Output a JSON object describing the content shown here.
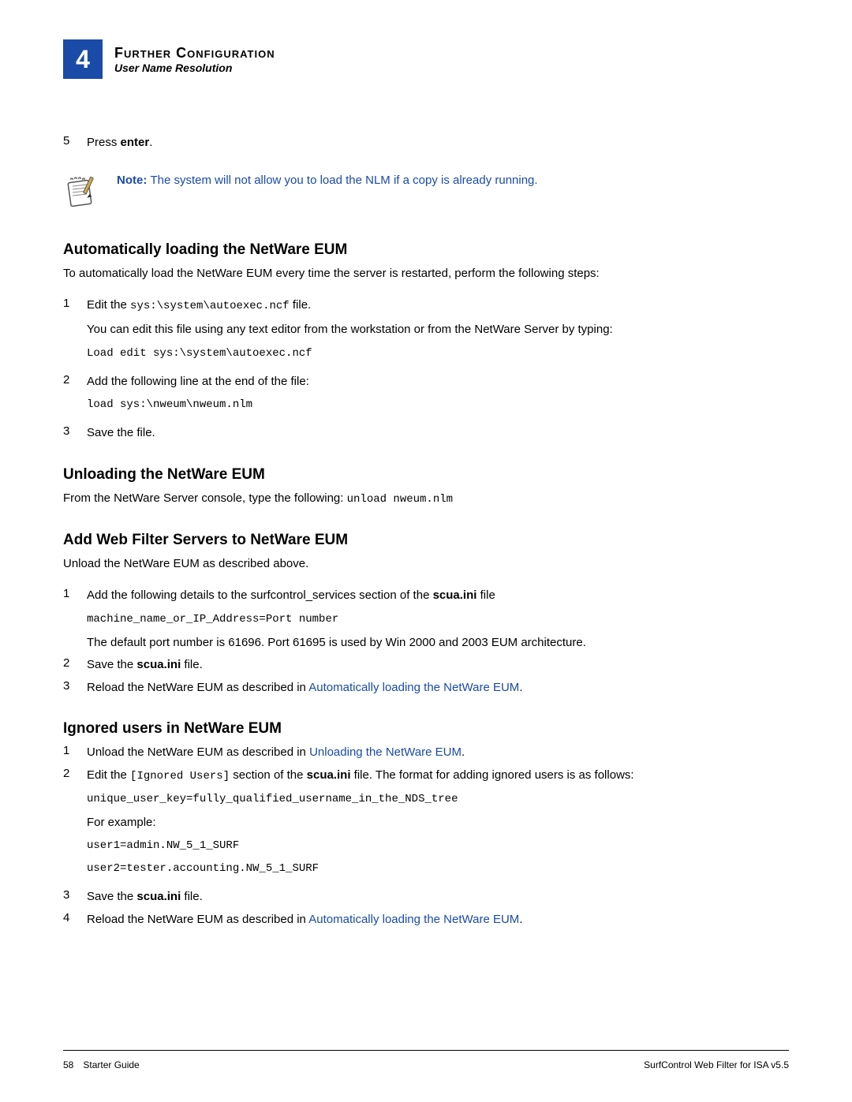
{
  "header": {
    "chapter_number": "4",
    "chapter_title": "Further Configuration",
    "section": "User Name Resolution"
  },
  "step5": {
    "num": "5",
    "pre": "Press ",
    "bold": "enter",
    "post": "."
  },
  "note": {
    "label": "Note: ",
    "text": "The system will not allow you to load the NLM if a copy is already running."
  },
  "auto": {
    "heading": "Automatically loading the NetWare EUM",
    "intro": "To automatically load the NetWare EUM every time the server is restarted, perform the following steps:",
    "s1": {
      "num": "1",
      "pre": "Edit the ",
      "code": "sys:\\system\\autoexec.ncf",
      "post": " file.",
      "line2": "You can edit this file using any text editor from the workstation or from the NetWare Server by typing:",
      "codeblock": "Load edit sys:\\system\\autoexec.ncf"
    },
    "s2": {
      "num": "2",
      "text": "Add the following line at the end of the file:",
      "codeblock": "load sys:\\nweum\\nweum.nlm"
    },
    "s3": {
      "num": "3",
      "text": "Save the file."
    }
  },
  "unload": {
    "heading": "Unloading the NetWare EUM",
    "pre": "From the NetWare Server console, type the following: ",
    "code": "unload nweum.nlm"
  },
  "addwf": {
    "heading": "Add Web Filter Servers to NetWare EUM",
    "intro": "Unload the NetWare EUM as described above.",
    "s1": {
      "num": "1",
      "pre": "Add the following details to the surfcontrol_services section of the ",
      "bold": "scua.ini",
      "post": " file",
      "codeblock": "machine_name_or_IP_Address=Port number",
      "line2": "The default port number is 61696. Port 61695 is used by Win 2000 and 2003 EUM architecture."
    },
    "s2": {
      "num": "2",
      "pre": "Save the ",
      "bold": "scua.ini",
      "post": " file."
    },
    "s3": {
      "num": "3",
      "pre": "Reload the NetWare EUM as described in ",
      "link": "Automatically loading the NetWare EUM",
      "post": "."
    }
  },
  "ignored": {
    "heading": "Ignored users in NetWare EUM",
    "s1": {
      "num": "1",
      "pre": "Unload the NetWare EUM as described in ",
      "link": "Unloading the NetWare EUM",
      "post": "."
    },
    "s2": {
      "num": "2",
      "pre": "Edit the ",
      "code": "[Ignored Users]",
      "mid": " section of the ",
      "bold": "scua.ini",
      "post": " file. The format for adding ignored users is as follows:",
      "codeblock1": "unique_user_key=fully_qualified_username_in_the_NDS_tree",
      "example_label": "For example:",
      "codeblock2": "user1=admin.NW_5_1_SURF",
      "codeblock3": "user2=tester.accounting.NW_5_1_SURF"
    },
    "s3": {
      "num": "3",
      "pre": "Save the ",
      "bold": "scua.ini",
      "post": " file."
    },
    "s4": {
      "num": "4",
      "pre": "Reload the NetWare EUM as described in ",
      "link": "Automatically loading the NetWare EUM",
      "post": "."
    }
  },
  "footer": {
    "page": "58",
    "left": "Starter Guide",
    "right": "SurfControl Web Filter for ISA v5.5"
  }
}
